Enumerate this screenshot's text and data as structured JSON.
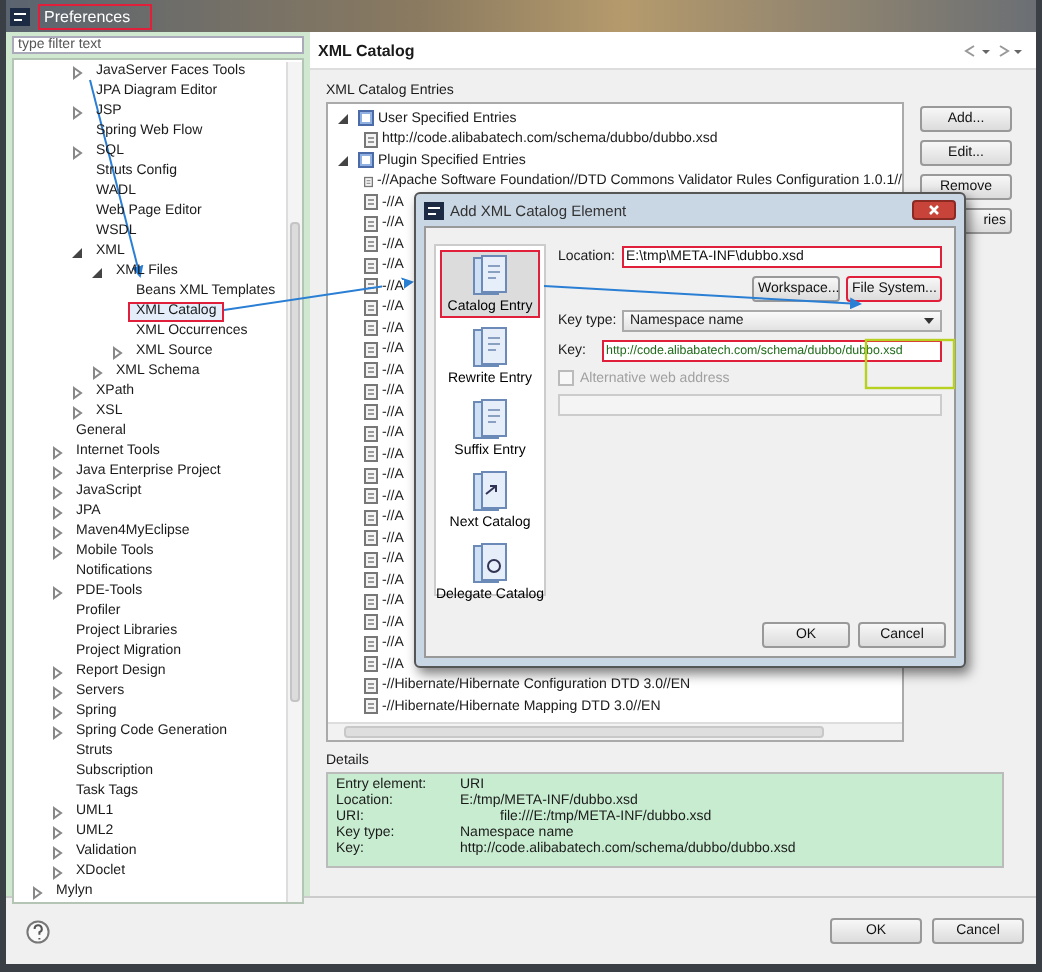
{
  "window": {
    "title": "Preferences",
    "highlighted": true
  },
  "filter": {
    "placeholder": "type filter text"
  },
  "tree": {
    "nested_items": [
      {
        "label": "JavaServer Faces Tools",
        "expanded": false,
        "selected": false,
        "highlighted": false
      },
      {
        "label": "JPA Diagram Editor",
        "selected": false,
        "highlighted": false
      },
      {
        "label": "JSP",
        "expanded": false,
        "selected": false,
        "highlighted": false
      },
      {
        "label": "Spring Web Flow",
        "selected": false,
        "highlighted": false
      },
      {
        "label": "SQL",
        "expanded": false,
        "selected": false,
        "highlighted": false
      },
      {
        "label": "Struts Config",
        "selected": false,
        "highlighted": false
      },
      {
        "label": "WADL",
        "selected": false,
        "highlighted": false
      },
      {
        "label": "Web Page Editor",
        "selected": false,
        "highlighted": false
      },
      {
        "label": "WSDL",
        "selected": false,
        "highlighted": false
      },
      {
        "label": "XML",
        "expanded": true,
        "selected": false,
        "highlighted": false,
        "children": [
          {
            "label": "XML Files",
            "expanded": true,
            "selected": false,
            "highlighted": false,
            "children": [
              {
                "label": "Beans XML Templates",
                "selected": false,
                "highlighted": false
              },
              {
                "label": "XML Catalog",
                "selected": true,
                "highlighted": true
              },
              {
                "label": "XML Occurrences",
                "selected": false,
                "highlighted": false
              },
              {
                "label": "XML Source",
                "expanded": false,
                "selected": false,
                "highlighted": false
              }
            ]
          },
          {
            "label": "XML Schema",
            "expanded": false,
            "selected": false,
            "highlighted": false
          }
        ]
      },
      {
        "label": "XPath",
        "expanded": false,
        "selected": false,
        "highlighted": false
      },
      {
        "label": "XSL",
        "expanded": false,
        "selected": false,
        "highlighted": false
      }
    ],
    "items": [
      {
        "label": "General",
        "selected": false,
        "highlighted": false
      },
      {
        "label": "Internet Tools",
        "expanded": false,
        "selected": false,
        "highlighted": false
      },
      {
        "label": "Java Enterprise Project",
        "expanded": false,
        "selected": false,
        "highlighted": false
      },
      {
        "label": "JavaScript",
        "expanded": false,
        "selected": false,
        "highlighted": false
      },
      {
        "label": "JPA",
        "expanded": false,
        "selected": false,
        "highlighted": false
      },
      {
        "label": "Maven4MyEclipse",
        "expanded": false,
        "selected": false,
        "highlighted": false
      },
      {
        "label": "Mobile Tools",
        "expanded": false,
        "selected": false,
        "highlighted": false
      },
      {
        "label": "Notifications",
        "selected": false,
        "highlighted": false
      },
      {
        "label": "PDE-Tools",
        "expanded": false,
        "selected": false,
        "highlighted": false
      },
      {
        "label": "Profiler",
        "selected": false,
        "highlighted": false
      },
      {
        "label": "Project Libraries",
        "selected": false,
        "highlighted": false
      },
      {
        "label": "Project Migration",
        "selected": false,
        "highlighted": false
      },
      {
        "label": "Report Design",
        "expanded": false,
        "selected": false,
        "highlighted": false
      },
      {
        "label": "Servers",
        "expanded": false,
        "selected": false,
        "highlighted": false
      },
      {
        "label": "Spring",
        "expanded": false,
        "selected": false,
        "highlighted": false
      },
      {
        "label": "Spring Code Generation",
        "expanded": false,
        "selected": false,
        "highlighted": false
      },
      {
        "label": "Struts",
        "selected": false,
        "highlighted": false
      },
      {
        "label": "Subscription",
        "selected": false,
        "highlighted": false
      },
      {
        "label": "Task Tags",
        "selected": false,
        "highlighted": false
      },
      {
        "label": "UML1",
        "expanded": false,
        "selected": false,
        "highlighted": false
      },
      {
        "label": "UML2",
        "expanded": false,
        "selected": false,
        "highlighted": false
      },
      {
        "label": "Validation",
        "expanded": false,
        "selected": false,
        "highlighted": false
      },
      {
        "label": "XDoclet",
        "expanded": false,
        "selected": false,
        "highlighted": false
      }
    ],
    "root_items": [
      {
        "label": "Mylyn",
        "expanded": false,
        "selected": false,
        "highlighted": false
      }
    ]
  },
  "page": {
    "title": "XML Catalog",
    "section": "XML Catalog Entries",
    "entries": [
      {
        "label": "User Specified Entries",
        "expanded": true,
        "children": [
          {
            "label": "http://code.alibabatech.com/schema/dubbo/dubbo.xsd"
          }
        ]
      },
      {
        "label": "Plugin Specified Entries",
        "expanded": true,
        "children": [
          {
            "label": "-//Apache Software Foundation//DTD Commons Validator Rules Configuration 1.0.1//"
          },
          {
            "label": "-//A"
          },
          {
            "label": "-//A"
          },
          {
            "label": "-//A"
          },
          {
            "label": "-//A"
          },
          {
            "label": "-//A"
          },
          {
            "label": "-//A"
          },
          {
            "label": "-//A"
          },
          {
            "label": "-//A"
          },
          {
            "label": "-//A"
          },
          {
            "label": "-//A"
          },
          {
            "label": "-//A"
          },
          {
            "label": "-//A"
          },
          {
            "label": "-//A"
          },
          {
            "label": "-//A"
          },
          {
            "label": "-//A"
          },
          {
            "label": "-//A"
          },
          {
            "label": "-//A"
          },
          {
            "label": "-//A"
          },
          {
            "label": "-//A"
          },
          {
            "label": "-//A"
          },
          {
            "label": "-//A"
          },
          {
            "label": "-//A"
          },
          {
            "label": "-//A"
          },
          {
            "label": "-//Hibernate/Hibernate Configuration DTD 3.0//EN"
          },
          {
            "label": "-//Hibernate/Hibernate Mapping DTD 3.0//EN"
          }
        ]
      }
    ],
    "buttons": [
      "Add...",
      "Edit...",
      "Remove",
      "ries"
    ],
    "details_title": "Details",
    "details": [
      {
        "label": "Entry element:",
        "value": "URI"
      },
      {
        "label": "Location:",
        "value": "E:/tmp/META-INF/dubbo.xsd"
      },
      {
        "label": "URI:",
        "value": "file:///E:/tmp/META-INF/dubbo.xsd"
      },
      {
        "label": "Key type:",
        "value": "Namespace name"
      },
      {
        "label": "Key:",
        "value": "http://code.alibabatech.com/schema/dubbo/dubbo.xsd"
      }
    ]
  },
  "dialog": {
    "title": "Add XML Catalog Element",
    "kinds": [
      {
        "label": "Catalog Entry",
        "selected": true,
        "highlighted": true
      },
      {
        "label": "Rewrite Entry",
        "selected": false,
        "highlighted": false
      },
      {
        "label": "Suffix Entry",
        "selected": false,
        "highlighted": false
      },
      {
        "label": "Next Catalog",
        "selected": false,
        "highlighted": false
      },
      {
        "label": "Delegate Catalog",
        "selected": false,
        "highlighted": false
      }
    ],
    "location": {
      "label": "Location:",
      "value": "E:\\tmp\\META-INF\\dubbo.xsd",
      "highlighted": true
    },
    "browse": [
      {
        "label": "Workspace...",
        "highlighted": false
      },
      {
        "label": "File System...",
        "highlighted": true
      }
    ],
    "key_type": {
      "label": "Key type:",
      "value": "Namespace name"
    },
    "key": {
      "label": "Key:",
      "value": "http://code.alibabatech.com/schema/dubbo/dubbo.xsd",
      "highlighted": true
    },
    "alternative": {
      "label": "Alternative web address",
      "checked": false,
      "disabled": true
    },
    "buttons": [
      "OK",
      "Cancel"
    ]
  },
  "buttons": [
    "OK",
    "Cancel"
  ]
}
